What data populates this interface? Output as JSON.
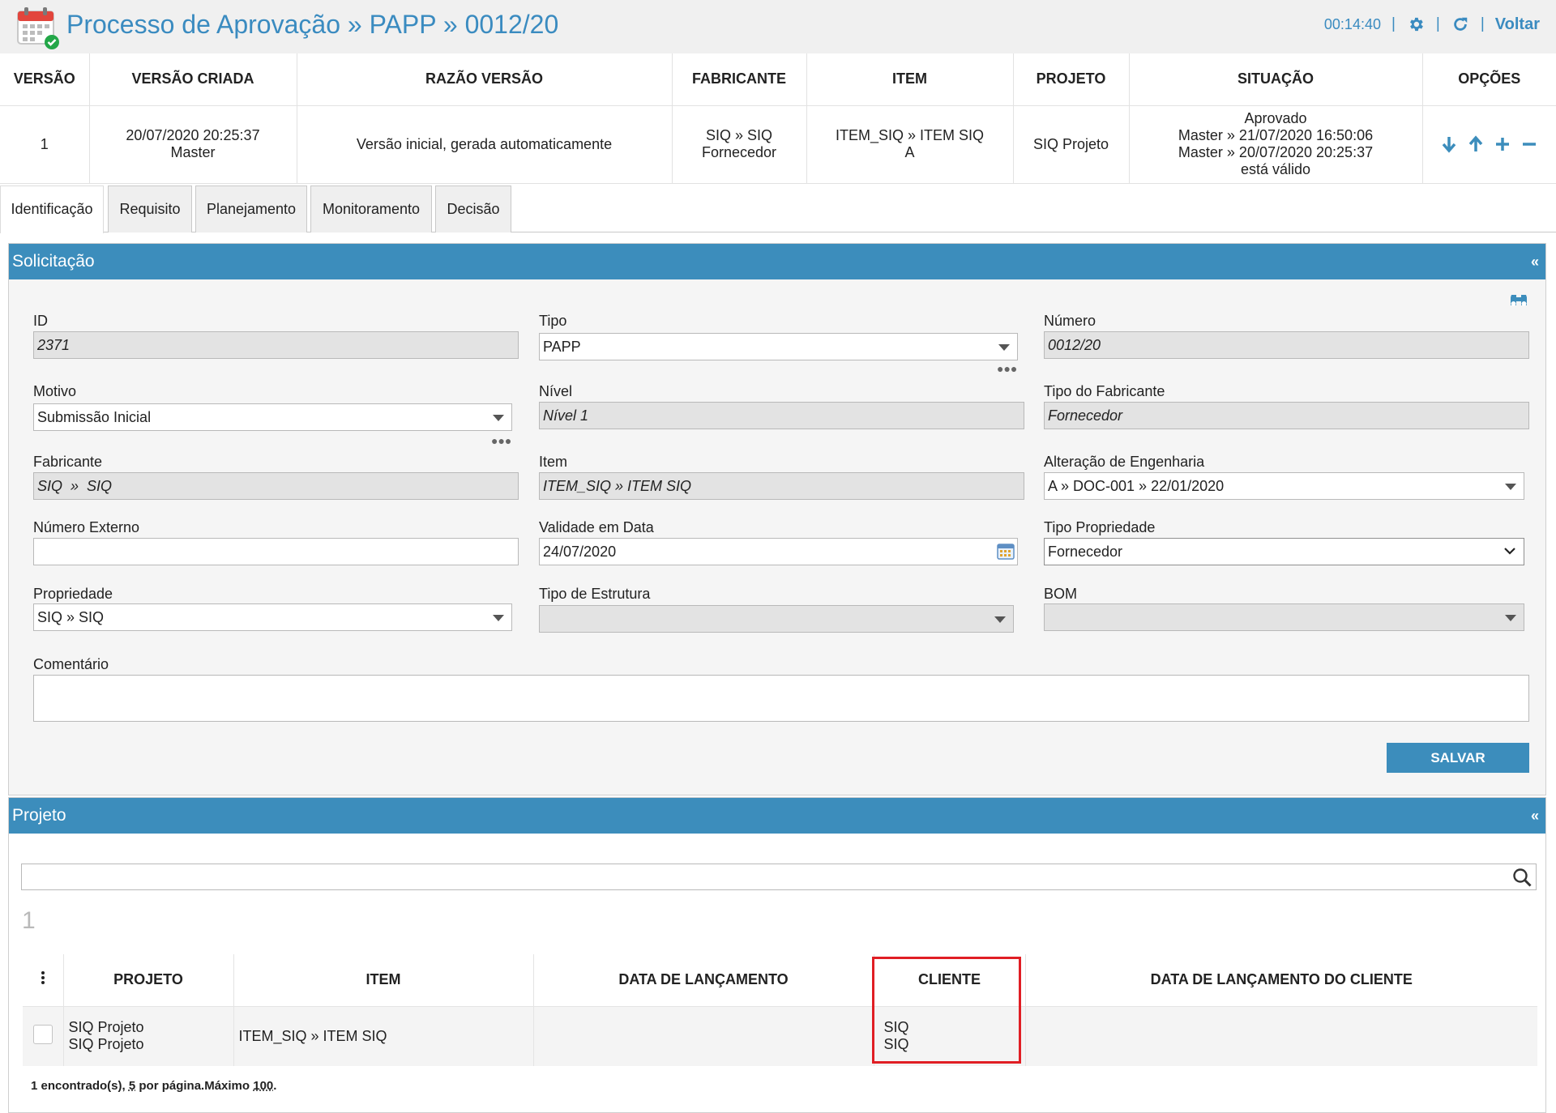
{
  "header": {
    "title": "Processo de Aprovação » PAPP » 0012/20",
    "clock": "00:14:40",
    "back_label": "Voltar"
  },
  "version_table": {
    "columns": [
      "VERSÃO",
      "VERSÃO CRIADA",
      "RAZÃO VERSÃO",
      "FABRICANTE",
      "ITEM",
      "PROJETO",
      "SITUAÇÃO",
      "OPÇÕES"
    ],
    "row": {
      "versao": "1",
      "criada_date": "20/07/2020 20:25:37",
      "criada_user": "Master",
      "razao": "Versão inicial, gerada automaticamente",
      "fabricante_1": "SIQ » SIQ",
      "fabricante_2": "Fornecedor",
      "item_1": "ITEM_SIQ » ITEM SIQ",
      "item_2": "A",
      "projeto": "SIQ Projeto",
      "situacao_1": "Aprovado",
      "situacao_2": "Master » 21/07/2020 16:50:06",
      "situacao_3": "Master » 20/07/2020 20:25:37",
      "situacao_4": "está válido"
    }
  },
  "tabs": [
    "Identificação",
    "Requisito",
    "Planejamento",
    "Monitoramento",
    "Decisão"
  ],
  "solicitacao": {
    "title": "Solicitação",
    "collapse": "«",
    "fields": {
      "id": {
        "label": "ID",
        "value": "2371"
      },
      "tipo": {
        "label": "Tipo",
        "value": "PAPP"
      },
      "numero": {
        "label": "Número",
        "value": "0012/20"
      },
      "motivo": {
        "label": "Motivo",
        "value": "Submissão Inicial"
      },
      "nivel": {
        "label": "Nível",
        "value": "Nível 1"
      },
      "tipo_fabricante": {
        "label": "Tipo do Fabricante",
        "value": "Fornecedor"
      },
      "fabricante": {
        "label": "Fabricante",
        "value": "SIQ  »  SIQ"
      },
      "item": {
        "label": "Item",
        "value": "ITEM_SIQ » ITEM SIQ"
      },
      "alteracao": {
        "label": "Alteração de Engenharia",
        "value": "A » DOC-001 » 22/01/2020"
      },
      "numero_externo": {
        "label": "Número Externo",
        "value": ""
      },
      "validade": {
        "label": "Validade em Data",
        "value": "24/07/2020"
      },
      "tipo_propriedade": {
        "label": "Tipo Propriedade",
        "value": "Fornecedor"
      },
      "propriedade": {
        "label": "Propriedade",
        "value": "SIQ » SIQ"
      },
      "tipo_estrutura": {
        "label": "Tipo de Estrutura",
        "value": ""
      },
      "bom": {
        "label": "BOM",
        "value": ""
      },
      "comentario": {
        "label": "Comentário",
        "value": ""
      }
    },
    "save_label": "SALVAR"
  },
  "projeto": {
    "title": "Projeto",
    "collapse": "«",
    "page_number": "1",
    "columns": [
      "PROJETO",
      "ITEM",
      "DATA DE LANÇAMENTO",
      "CLIENTE",
      "DATA DE LANÇAMENTO DO CLIENTE"
    ],
    "row": {
      "projeto_1": "SIQ Projeto",
      "projeto_2": "SIQ Projeto",
      "item": "ITEM_SIQ » ITEM SIQ",
      "data_lancamento": "",
      "cliente_1": "SIQ",
      "cliente_2": "SIQ",
      "data_cliente": ""
    },
    "footer": {
      "found": "1 encontrado(s),",
      "per_page_num": "5",
      "per_page_text": "por página.Máximo",
      "max_num": "100",
      "end": "."
    }
  },
  "colors": {
    "accent": "#3c8dbc",
    "title": "#3a8bc0",
    "highlight": "#e01e24"
  },
  "icons": [
    "calendar-check-icon",
    "gear-icon",
    "refresh-icon",
    "arrow-down-icon",
    "arrow-up-icon",
    "plus-icon",
    "minus-icon",
    "binoculars-icon",
    "calendar-icon",
    "search-icon",
    "kebab-menu-icon"
  ]
}
